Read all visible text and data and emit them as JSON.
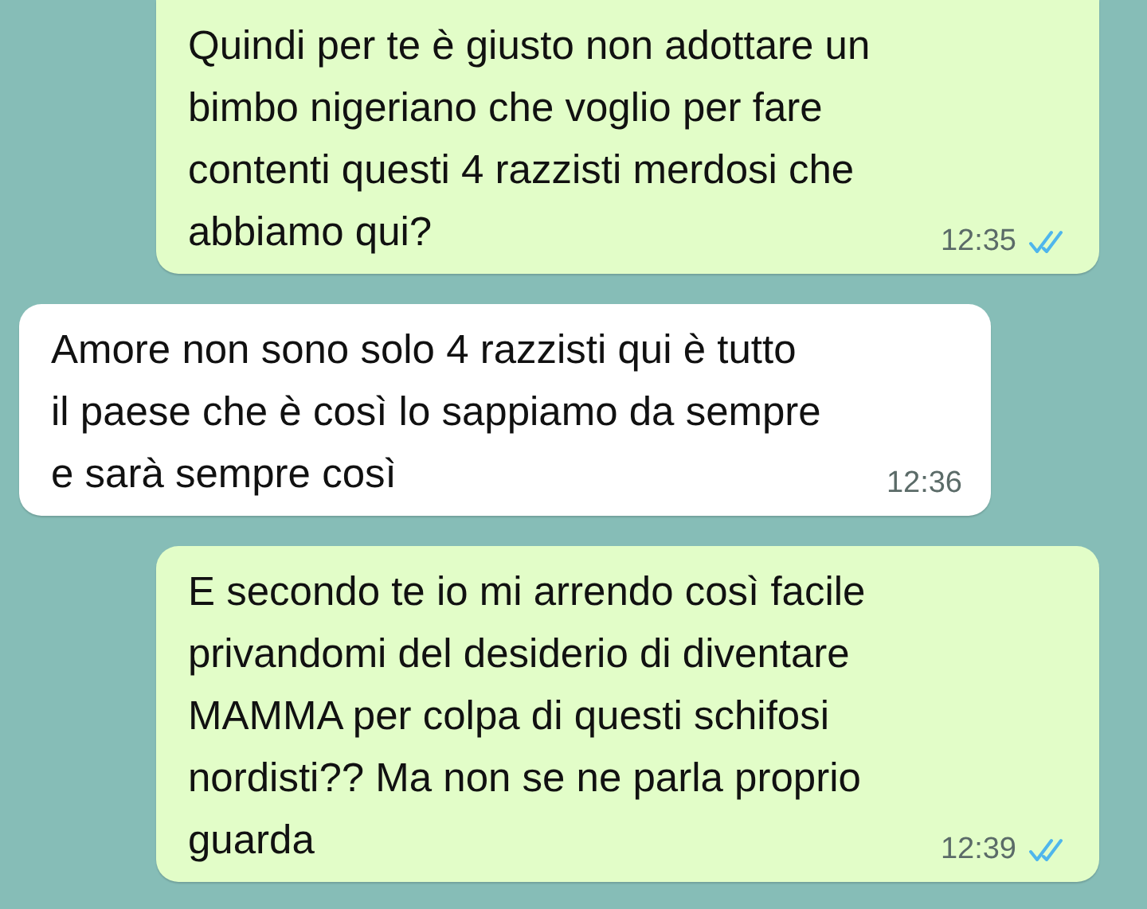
{
  "messages": [
    {
      "kind": "outgoing",
      "text": "Quindi per te è giusto non adottare un\nbimbo nigeriano che voglio per fare\ncontenti questi 4 razzisti merdosi che\nabbiamo qui?",
      "time": "12:35",
      "read": true
    },
    {
      "kind": "incoming",
      "text": "Amore non sono solo 4 razzisti qui è tutto\nil paese che è così lo sappiamo da sempre\ne sarà sempre così",
      "time": "12:36"
    },
    {
      "kind": "outgoing",
      "text": "E secondo te io mi arrendo così facile\nprivandomi del desiderio di diventare\nMAMMA per colpa di questi schifosi\nnordisti?? Ma non se ne parla proprio\nguarda",
      "time": "12:39",
      "read": true
    }
  ]
}
